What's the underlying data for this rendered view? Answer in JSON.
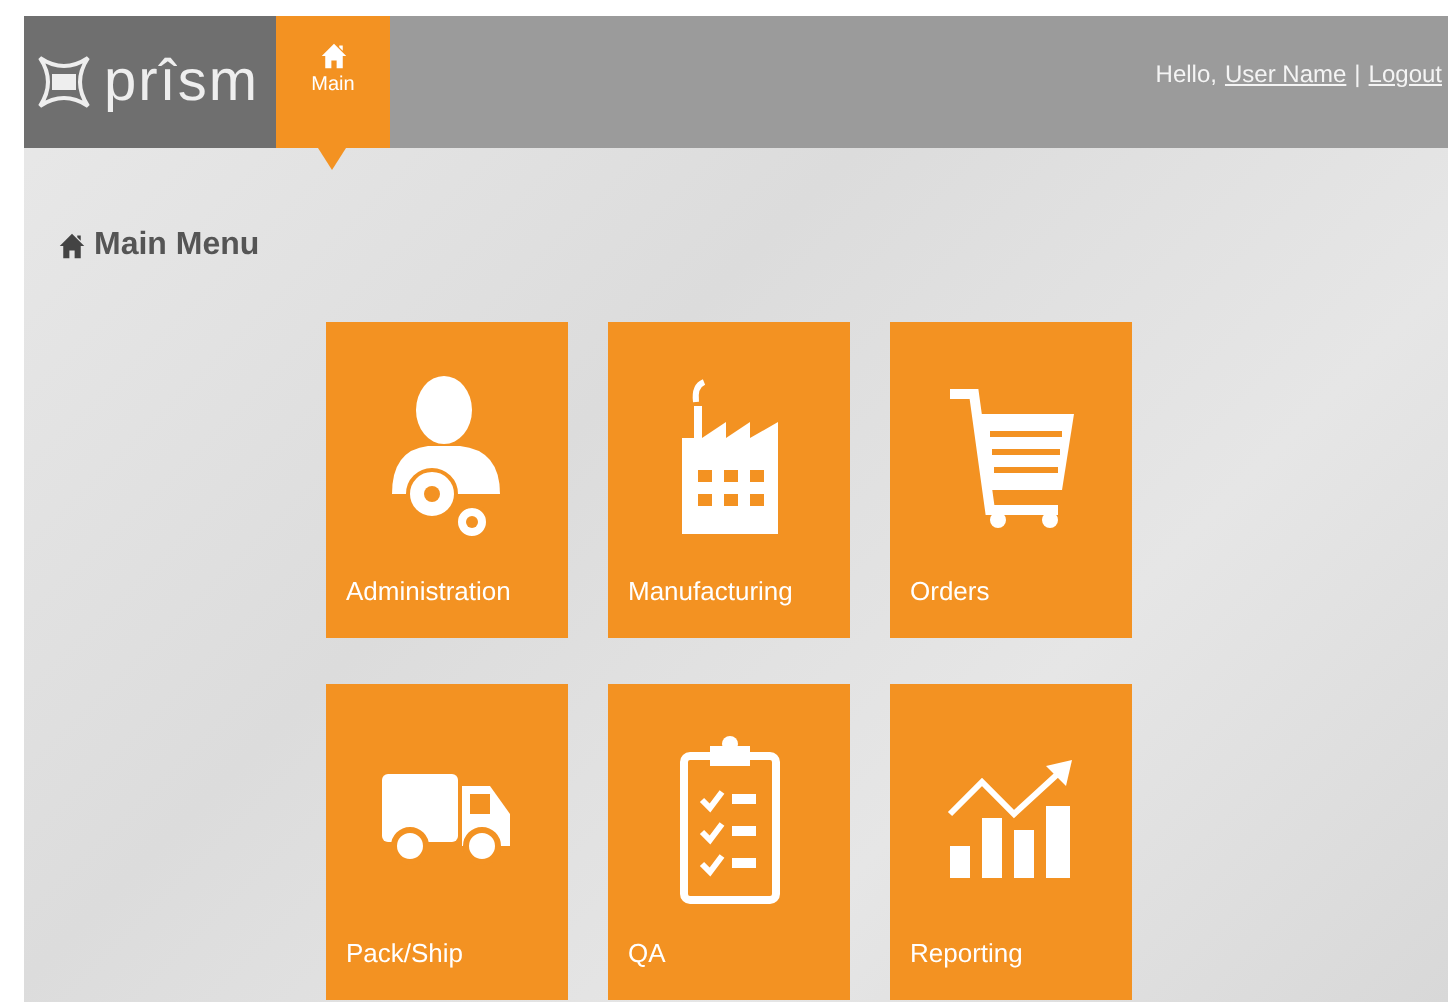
{
  "header": {
    "logo": "prîsm",
    "tabs": [
      {
        "label": "Main",
        "selected": true
      }
    ],
    "greeting": "Hello,",
    "user_link": "User Name",
    "separator": "|",
    "logout_link": "Logout"
  },
  "heading": "Main Menu",
  "tiles": [
    {
      "label": "Administration",
      "kind": "admin"
    },
    {
      "label": "Manufacturing",
      "kind": "factory"
    },
    {
      "label": "Orders",
      "kind": "cart"
    },
    {
      "label": "Pack/Ship",
      "kind": "truck"
    },
    {
      "label": "QA",
      "kind": "clipboard"
    },
    {
      "label": "Reporting",
      "kind": "chart"
    }
  ]
}
